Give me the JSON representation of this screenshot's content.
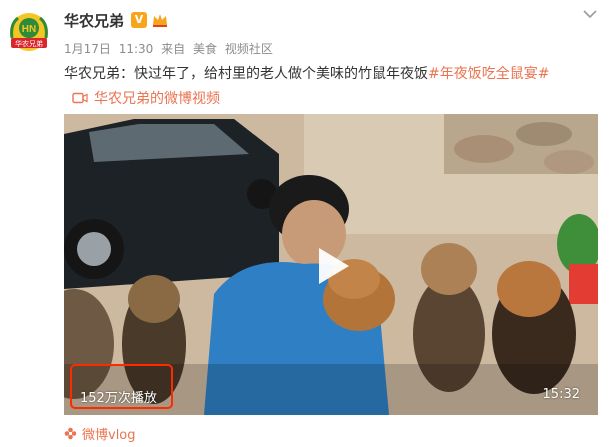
{
  "user": {
    "name": "华农兄弟",
    "avatar_text": "华农兄弟",
    "avatar_initials": "HN"
  },
  "meta": {
    "date": "1月17日",
    "time": "11:30",
    "from_label": "来自",
    "category": "美食",
    "community": "视频社区"
  },
  "post": {
    "text": "华农兄弟：快过年了，给村里的老人做个美味的竹鼠年夜饭",
    "hashtag": "#年夜饭吃全鼠宴#"
  },
  "video_link": {
    "label": "华农兄弟的微博视频"
  },
  "video": {
    "play_count": "152万次播放",
    "duration": "15:32"
  },
  "source": {
    "label": "微博vlog"
  },
  "colors": {
    "accent": "#eb7350",
    "highlight_box": "#ff2a00",
    "vip": "#f7a51c"
  }
}
